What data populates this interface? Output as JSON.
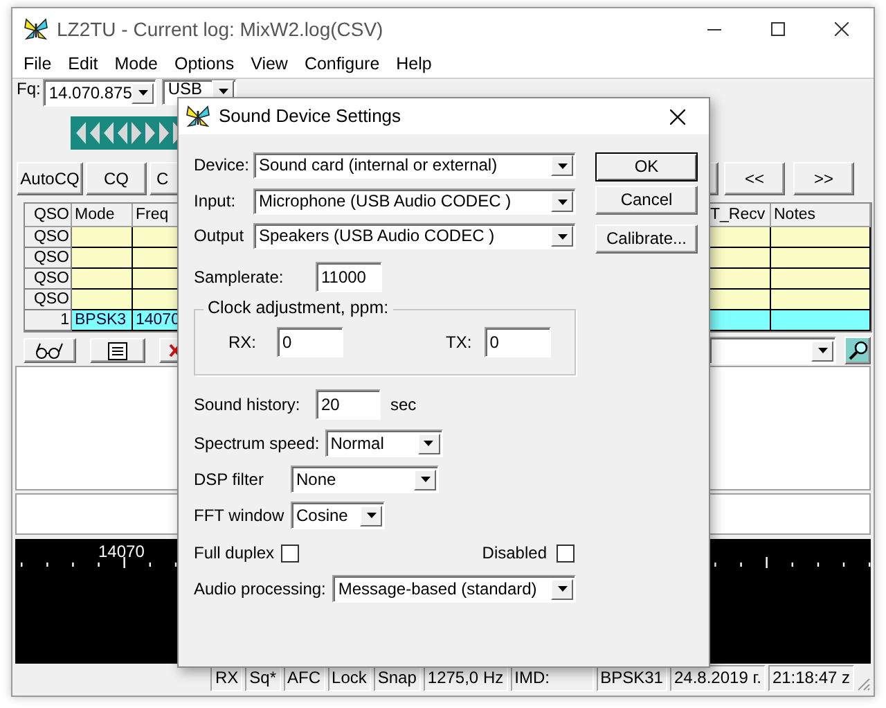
{
  "window": {
    "title": "LZ2TU - Current log: MixW2.log(CSV)"
  },
  "menu": [
    {
      "label": "File"
    },
    {
      "label": "Edit"
    },
    {
      "label": "Mode"
    },
    {
      "label": "Options"
    },
    {
      "label": "View"
    },
    {
      "label": "Configure"
    },
    {
      "label": "Help"
    }
  ],
  "toolbar": {
    "frequency_label": "Fq:",
    "frequency": "14.070.875",
    "mode": "USB"
  },
  "buttons_left": [
    "AutoCQ",
    "CQ",
    "C"
  ],
  "buttons_right": [
    "<<",
    ">>"
  ],
  "log_table": {
    "columns": [
      "QSO",
      "Mode",
      "Freq",
      "T_Recv",
      "Notes"
    ],
    "rows": [
      {
        "header": "QSO",
        "highlighted": false
      },
      {
        "header": "QSO",
        "highlighted": false
      },
      {
        "header": "QSO",
        "highlighted": false
      },
      {
        "header": "QSO",
        "highlighted": false
      },
      {
        "header": "1",
        "highlighted": true,
        "mode": "BPSK3",
        "freq": "14070"
      }
    ]
  },
  "waterfall": {
    "scale_label": "14070"
  },
  "status_bar": [
    "RX",
    "Sq*",
    "AFC",
    "Lock",
    "Snap",
    "1275,0 Hz",
    "IMD:",
    "BPSK31",
    "24.8.2019 г.",
    "21:18:47 z"
  ],
  "dialog": {
    "title": "Sound Device Settings",
    "device": {
      "label": "Device:",
      "value": "Sound card (internal or external)"
    },
    "input": {
      "label": "Input:",
      "value": "Microphone (USB Audio CODEC )"
    },
    "output": {
      "label": "Output",
      "value": "Speakers (USB Audio CODEC )"
    },
    "samplerate": {
      "label": "Samplerate:",
      "value": "11000"
    },
    "clock": {
      "title": "Clock adjustment, ppm:",
      "rx_label": "RX:",
      "rx": "0",
      "tx_label": "TX:",
      "tx": "0"
    },
    "sound_history": {
      "label": "Sound history:",
      "value": "20",
      "unit": "sec"
    },
    "spectrum_speed": {
      "label": "Spectrum speed:",
      "value": "Normal"
    },
    "dsp_filter": {
      "label": "DSP filter",
      "value": "None"
    },
    "fft_window": {
      "label": "FFT window",
      "value": "Cosine"
    },
    "full_duplex": {
      "label": "Full duplex",
      "checked": false
    },
    "disabled": {
      "label": "Disabled",
      "checked": false
    },
    "audio_processing": {
      "label": "Audio processing:",
      "value": "Message-based (standard)"
    },
    "buttons": [
      {
        "label": "OK",
        "default": true
      },
      {
        "label": "Cancel",
        "default": false
      },
      {
        "label": "Calibrate...",
        "default": false
      }
    ]
  }
}
